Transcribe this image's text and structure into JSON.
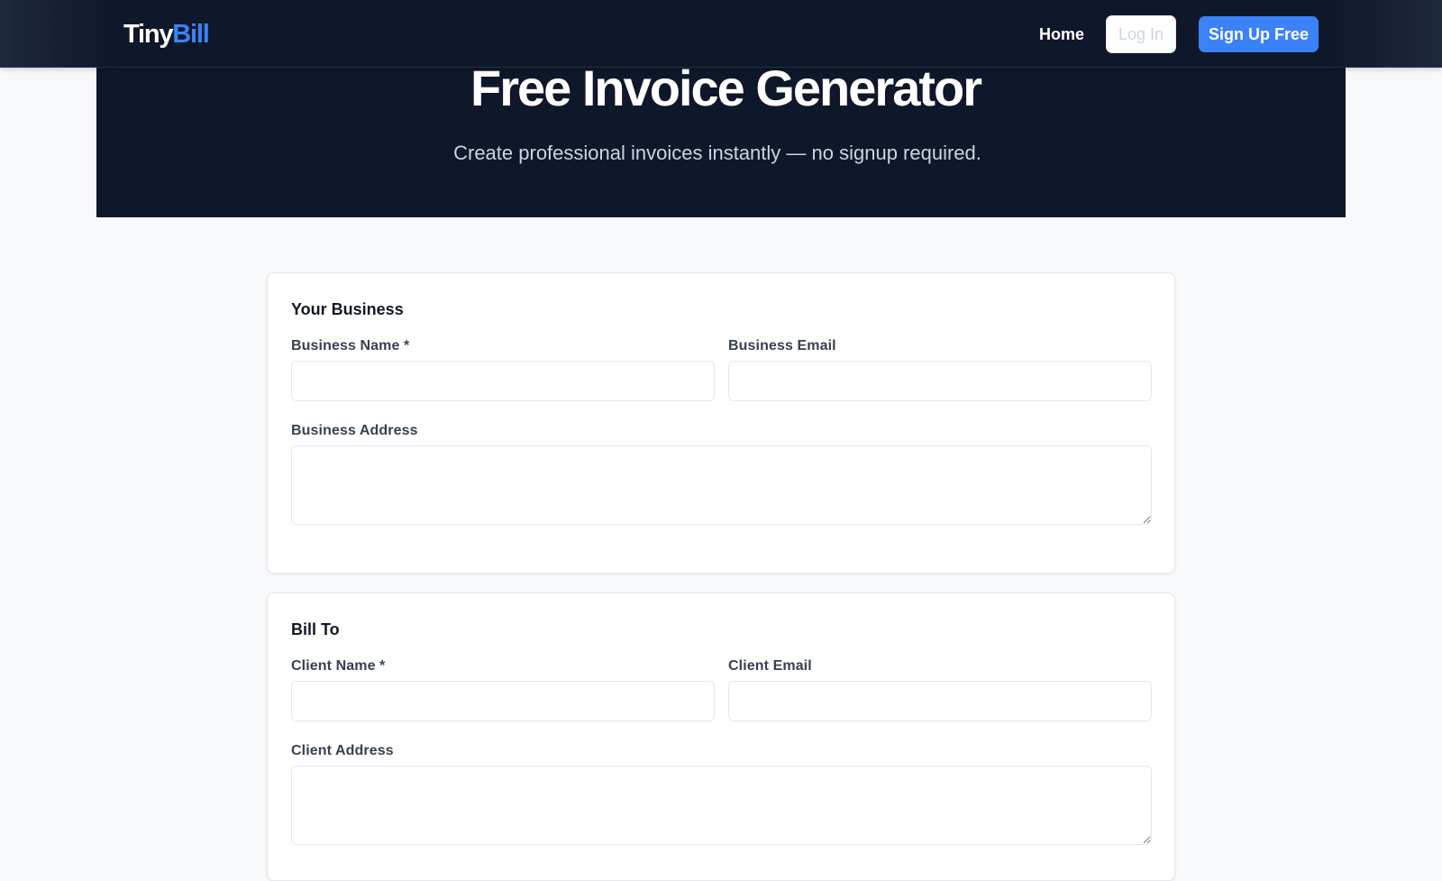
{
  "nav": {
    "logo_part1": "Tiny",
    "logo_part2": "Bill",
    "home_label": "Home",
    "login_label": "Log In",
    "signup_label": "Sign Up Free"
  },
  "hero": {
    "title": "Free Invoice Generator",
    "subtitle": "Create professional invoices instantly — no signup required."
  },
  "business_section": {
    "title": "Your Business",
    "name_label": "Business Name *",
    "name_value": "",
    "email_label": "Business Email",
    "email_value": "",
    "address_label": "Business Address",
    "address_value": ""
  },
  "bill_to_section": {
    "title": "Bill To",
    "name_label": "Client Name *",
    "name_value": "",
    "email_label": "Client Email",
    "email_value": "",
    "address_label": "Client Address",
    "address_value": ""
  },
  "colors": {
    "nav_background": "#0f172a",
    "accent": "#3b82f6",
    "page_background": "#f7f9fb"
  }
}
